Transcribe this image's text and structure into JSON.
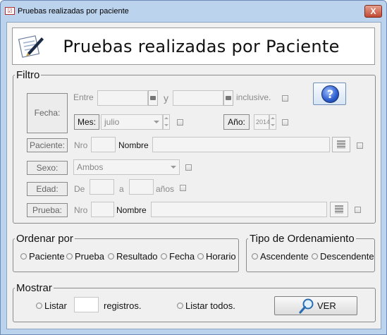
{
  "window": {
    "title": "Pruebas realizadas por paciente",
    "close_label": "X"
  },
  "header": {
    "title": "Pruebas realizadas por Paciente"
  },
  "filtro": {
    "legend": "Filtro",
    "fecha": {
      "label": "Fecha:",
      "entre": "Entre",
      "y": "y",
      "inclusive": "inclusive.",
      "from_value": "",
      "to_value": ""
    },
    "mes": {
      "label": "Mes:",
      "value": "julio"
    },
    "anio": {
      "label": "Año:",
      "value": "2014"
    },
    "paciente": {
      "label": "Paciente:",
      "nro": "Nro",
      "nombre": "Nombre",
      "nro_value": "",
      "nombre_value": ""
    },
    "sexo": {
      "label": "Sexo:",
      "value": "Ambos"
    },
    "edad": {
      "label": "Edad:",
      "de": "De",
      "a": "a",
      "anios": "años",
      "from_value": "",
      "to_value": ""
    },
    "prueba": {
      "label": "Prueba:",
      "nro": "Nro",
      "nombre": "Nombre",
      "nro_value": "",
      "nombre_value": ""
    },
    "help_label": "?"
  },
  "ordenar": {
    "legend": "Ordenar por",
    "options": [
      "Paciente",
      "Prueba",
      "Resultado",
      "Fecha",
      "Horario"
    ]
  },
  "tipo": {
    "legend": "Tipo de Ordenamiento",
    "options": [
      "Ascendente",
      "Descendente"
    ]
  },
  "mostrar": {
    "legend": "Mostrar",
    "listar": "Listar",
    "registros": "registros.",
    "listar_todos": "Listar todos.",
    "count_value": "",
    "ver_label": "VER"
  }
}
